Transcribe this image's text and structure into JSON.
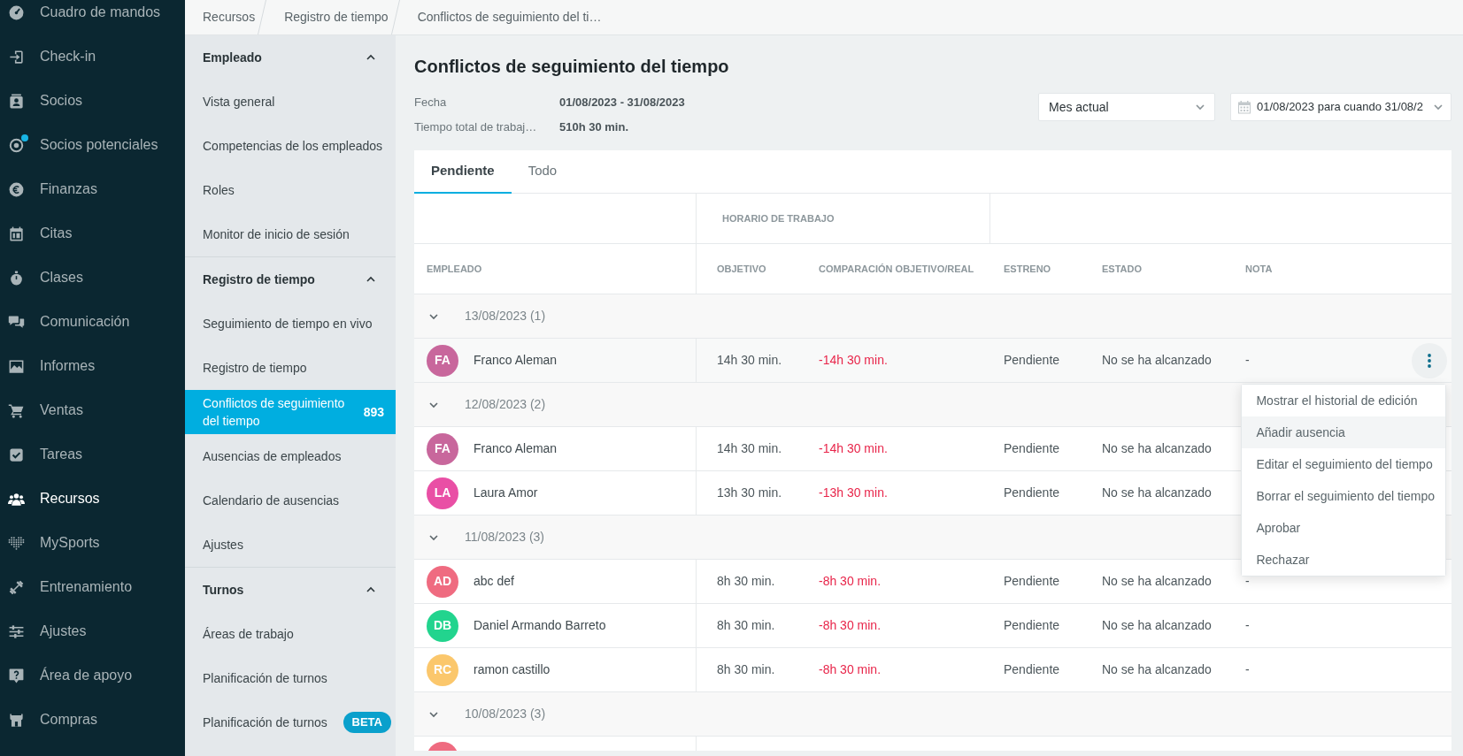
{
  "sidebar": {
    "items": [
      {
        "label": "Cuadro de mandos",
        "selected": false,
        "notification": false
      },
      {
        "label": "Check-in",
        "selected": false,
        "notification": false
      },
      {
        "label": "Socios",
        "selected": false,
        "notification": false
      },
      {
        "label": "Socios potenciales",
        "selected": false,
        "notification": true
      },
      {
        "label": "Finanzas",
        "selected": false,
        "notification": false
      },
      {
        "label": "Citas",
        "selected": false,
        "notification": false
      },
      {
        "label": "Clases",
        "selected": false,
        "notification": false
      },
      {
        "label": "Comunicación",
        "selected": false,
        "notification": false
      },
      {
        "label": "Informes",
        "selected": false,
        "notification": false
      },
      {
        "label": "Ventas",
        "selected": false,
        "notification": false
      },
      {
        "label": "Tareas",
        "selected": false,
        "notification": false
      },
      {
        "label": "Recursos",
        "selected": true,
        "notification": false
      },
      {
        "label": "MySports",
        "selected": false,
        "notification": false
      },
      {
        "label": "Entrenamiento",
        "selected": false,
        "notification": false
      },
      {
        "label": "Ajustes",
        "selected": false,
        "notification": false
      },
      {
        "label": "Área de apoyo",
        "selected": false,
        "notification": false
      },
      {
        "label": "Compras",
        "selected": false,
        "notification": false
      }
    ]
  },
  "breadcrumb": [
    {
      "label": "Recursos"
    },
    {
      "label": "Registro de tiempo"
    },
    {
      "label": "Conflictos de seguimiento del ti…"
    }
  ],
  "subnav": {
    "sections": [
      {
        "title": "Empleado",
        "expanded": true,
        "items": [
          {
            "label": "Vista general",
            "selected": false
          },
          {
            "label": "Competencias de los empleados",
            "selected": false
          },
          {
            "label": "Roles",
            "selected": false
          },
          {
            "label": "Monitor de inicio de sesión",
            "selected": false
          }
        ]
      },
      {
        "title": "Registro de tiempo",
        "expanded": true,
        "items": [
          {
            "label": "Seguimiento de tiempo en vivo",
            "selected": false
          },
          {
            "label": "Registro de tiempo",
            "selected": false
          },
          {
            "label": "Conflictos de seguimiento del tiempo",
            "selected": true,
            "count": "893"
          },
          {
            "label": "Ausencias de empleados",
            "selected": false
          },
          {
            "label": "Calendario de ausencias",
            "selected": false
          },
          {
            "label": "Ajustes",
            "selected": false
          }
        ]
      },
      {
        "title": "Turnos",
        "expanded": true,
        "items": [
          {
            "label": "Áreas de trabajo",
            "selected": false
          },
          {
            "label": "Planificación de turnos",
            "selected": false
          },
          {
            "label": "Planificación de turnos",
            "selected": false,
            "tag": "BETA"
          }
        ]
      }
    ]
  },
  "page": {
    "title": "Conflictos de seguimiento del tiempo",
    "summary": [
      {
        "label": "Fecha",
        "value": "01/08/2023 - 31/08/2023"
      },
      {
        "label": "Tiempo total de trabaj…",
        "value": "510h 30 min."
      }
    ],
    "period_select": {
      "value": "Mes actual"
    },
    "date_range": {
      "value": "01/08/2023 para cuando 31/08/2"
    }
  },
  "tabs": [
    {
      "label": "Pendiente",
      "selected": true
    },
    {
      "label": "Todo",
      "selected": false
    }
  ],
  "table": {
    "group_header": "HORARIO DE TRABAJO",
    "columns": [
      "EMPLEADO",
      "OBJETIVO",
      "COMPARACIÓN OBJETIVO/REAL",
      "ESTRENO",
      "ESTADO",
      "NOTA"
    ],
    "rows": [
      {
        "kind": "group",
        "label": "13/08/2023 (1)",
        "expanded": true
      },
      {
        "kind": "employee",
        "initials": "FA",
        "name": "Franco Aleman",
        "color": "#c8679c",
        "target": "14h 30 min.",
        "difference": "-14h 30 min.",
        "release": "Pendiente",
        "status": "No se ha alcanzado",
        "note": "-",
        "hovered": true,
        "menu": {
          "items": [
            {
              "label": "Mostrar el historial de edición",
              "highlighted": false
            },
            {
              "label": "Añadir ausencia",
              "highlighted": true
            },
            {
              "label": "Editar el seguimiento del tiempo",
              "highlighted": false
            },
            {
              "label": "Borrar el seguimiento del tiempo",
              "highlighted": false
            },
            {
              "label": "Aprobar",
              "highlighted": false
            },
            {
              "label": "Rechazar",
              "highlighted": false
            }
          ]
        }
      },
      {
        "kind": "group",
        "label": "12/08/2023 (2)",
        "expanded": true
      },
      {
        "kind": "employee",
        "initials": "FA",
        "name": "Franco Aleman",
        "color": "#c8679c",
        "target": "14h 30 min.",
        "difference": "-14h 30 min.",
        "release": "Pendiente",
        "status": "No se ha alcanzado",
        "hovered": false
      },
      {
        "kind": "employee",
        "initials": "LA",
        "name": "Laura Amor",
        "color": "#e94fa5",
        "target": "13h 30 min.",
        "difference": "-13h 30 min.",
        "release": "Pendiente",
        "status": "No se ha alcanzado",
        "hovered": false
      },
      {
        "kind": "group",
        "label": "11/08/2023 (3)",
        "expanded": true
      },
      {
        "kind": "employee",
        "initials": "AD",
        "name": "abc def",
        "color": "#ef6b80",
        "target": "8h 30 min.",
        "difference": "-8h 30 min.",
        "release": "Pendiente",
        "status": "No se ha alcanzado",
        "note": "-",
        "hovered": false
      },
      {
        "kind": "employee",
        "initials": "DB",
        "name": "Daniel Armando Barreto",
        "color": "#22d48e",
        "target": "8h 30 min.",
        "difference": "-8h 30 min.",
        "release": "Pendiente",
        "status": "No se ha alcanzado",
        "note": "-",
        "hovered": false
      },
      {
        "kind": "employee",
        "initials": "RC",
        "name": "ramon castillo",
        "color": "#fbc76c",
        "target": "8h 30 min.",
        "difference": "-8h 30 min.",
        "release": "Pendiente",
        "status": "No se ha alcanzado",
        "note": "-",
        "hovered": false
      },
      {
        "kind": "group",
        "label": "10/08/2023 (3)",
        "expanded": true
      },
      {
        "kind": "partial",
        "color": "#ef6b80"
      }
    ]
  }
}
